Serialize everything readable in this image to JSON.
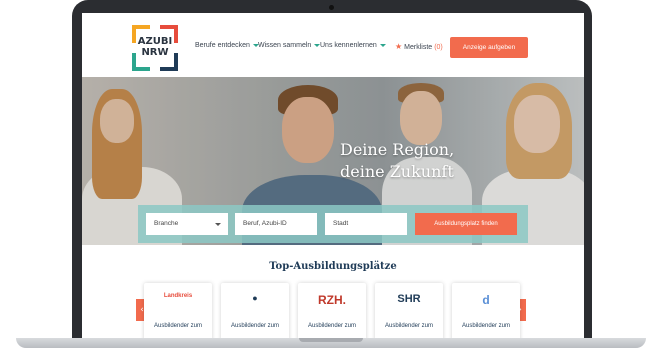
{
  "brand": {
    "logo_text_line1": "AZUBI",
    "logo_text_line2": "NRW"
  },
  "nav": {
    "items": [
      {
        "label": "Berufe entdecken"
      },
      {
        "label": "Wissen sammeln"
      },
      {
        "label": "Uns kennenlernen"
      }
    ],
    "merkliste_label": "Merkliste",
    "merkliste_count": "(0)",
    "cta_label": "Anzeige aufgeben"
  },
  "hero": {
    "title_line1": "Deine Region,",
    "title_line2": "deine Zukunft"
  },
  "search": {
    "branche_value": "Branche",
    "beruf_placeholder": "Beruf, Azubi-ID",
    "stadt_placeholder": "Stadt",
    "button_label": "Ausbildungsplatz finden"
  },
  "top_section": {
    "title": "Top-Ausbildungsplätze",
    "prev_arrow": "‹",
    "next_arrow": "›",
    "cards": [
      {
        "logo_text": "Landkreis",
        "label": "Ausbildender zum"
      },
      {
        "logo_text": "●",
        "label": "Ausbildender zum"
      },
      {
        "logo_text": "RZH.",
        "label": "Ausbildender zum"
      },
      {
        "logo_text": "SHR",
        "label": "Ausbildender zum"
      },
      {
        "logo_text": "d",
        "label": "Ausbildender zum"
      }
    ]
  },
  "colors": {
    "accent_orange": "#f26b4d",
    "teal": "#2ca58d",
    "navy": "#1f3b57",
    "search_bar": "#8cc8c4"
  }
}
